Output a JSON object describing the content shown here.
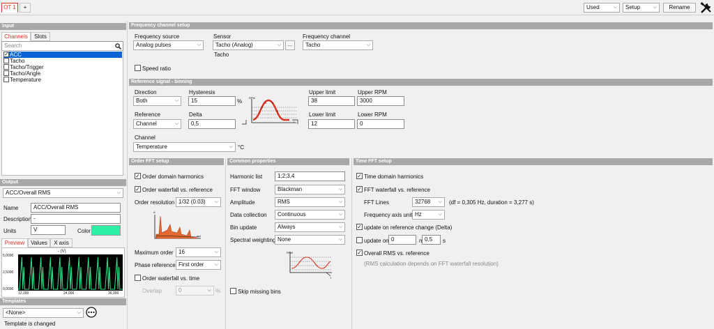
{
  "topbar": {
    "tabs": [
      {
        "label": "OT 1"
      },
      {
        "label": "+"
      }
    ],
    "used_select": "Used",
    "setup_select": "Setup",
    "rename_button": "Rename"
  },
  "colors": {
    "accent_red": "#d7301f",
    "header_gray": "#a8a8a8",
    "selection_blue": "#0a64d7",
    "color_swatch": "#2ef0a4",
    "trace_green": "#2ee88c"
  },
  "input": {
    "header": "Input",
    "tabs": [
      "Channels",
      "Slots"
    ],
    "search_placeholder": "Search",
    "channels": [
      {
        "label": "ACC",
        "checked": true,
        "selected": true
      },
      {
        "label": "Tacho",
        "checked": false,
        "selected": false
      },
      {
        "label": "Tacho/Trigger",
        "checked": false,
        "selected": false
      },
      {
        "label": "Tacho/Angle",
        "checked": false,
        "selected": false
      },
      {
        "label": "Temperature",
        "checked": false,
        "selected": false
      }
    ]
  },
  "output": {
    "header": "Output",
    "selected": "ACC/Overall RMS",
    "name_label": "Name",
    "name_value": "ACC/Overall RMS",
    "description_label": "Description",
    "description_value": "-",
    "units_label": "Units",
    "units_value": "V",
    "color_label": "Color",
    "tabs": [
      "Preview",
      "Values",
      "X axis"
    ],
    "preview_title": "- (V)",
    "y_ticks": [
      "5,0000",
      "2,5000",
      "0,0000"
    ],
    "x_ticks": [
      "12,000",
      "24,000",
      "36,000"
    ]
  },
  "templates": {
    "header": "Templates",
    "selected": "<None>",
    "status": "Template is changed"
  },
  "freq_setup": {
    "header": "Frequency channel setup",
    "source_label": "Frequency source",
    "source_value": "Analog pulses",
    "sensor_label": "Sensor",
    "sensor_value": "Tacho (Analog)",
    "sensor_browse": "...",
    "sensor_sub": "Tacho",
    "channel_label": "Frequency channel",
    "channel_value": "Tacho",
    "speed_ratio": "Speed ratio"
  },
  "reference": {
    "header": "Reference signal - binning",
    "direction_label": "Direction",
    "direction_value": "Both",
    "hysteresis_label": "Hysteresis",
    "hysteresis_value": "15",
    "hysteresis_unit": "%",
    "reference_label": "Reference",
    "reference_value": "Channel",
    "delta_label": "Delta",
    "delta_value": "0,5",
    "upper_limit_label": "Upper limit",
    "upper_limit_value": "38",
    "upper_rpm_label": "Upper RPM",
    "upper_rpm_value": "3000",
    "lower_limit_label": "Lower limit",
    "lower_limit_value": "12",
    "lower_rpm_label": "Lower RPM",
    "lower_rpm_value": "0",
    "channel_label": "Channel",
    "channel_value": "Temperature",
    "channel_unit": "°C",
    "graphic_y": "RPM",
    "graphic_x": "t"
  },
  "order_fft": {
    "header": "Order FFT setup",
    "domain_harmonics": "Order domain harmonics",
    "waterfall_ref": "Order waterfall vs. reference",
    "resolution_label": "Order resolution",
    "resolution_value": "1/32 (0.03)",
    "graphic_y": "A",
    "graphic_x": "ord",
    "max_order_label": "Maximum order",
    "max_order_value": "16",
    "phase_ref_label": "Phase reference",
    "phase_ref_value": "First order",
    "waterfall_time": "Order waterfall vs. time",
    "overlap_label": "Overlap",
    "overlap_value": "0",
    "overlap_unit": "%"
  },
  "common": {
    "header": "Common properties",
    "harmonic_list_label": "Harmonic list",
    "harmonic_list_value": "1;2;3,4",
    "fft_window_label": "FFT window",
    "fft_window_value": "Blackman",
    "amplitude_label": "Amplitude",
    "amplitude_value": "RMS",
    "data_collection_label": "Data collection",
    "data_collection_value": "Continuous",
    "bin_update_label": "Bin update",
    "bin_update_value": "Always",
    "spectral_weighting_label": "Spectral weighting",
    "spectral_weighting_value": "None",
    "graphic_y": "RPM",
    "graphic_x": "t",
    "skip_missing": "Skip missing bins"
  },
  "time_fft": {
    "header": "Time FFT setup",
    "domain_harmonics": "Time domain harmonics",
    "waterfall_ref": "FFT waterfall vs. reference",
    "fft_lines_label": "FFT Lines",
    "fft_lines_value": "32768",
    "fft_lines_info": "(df = 0,305 Hz, duration = 3,277 s)",
    "freq_unit_label": "Frequency axis unit",
    "freq_unit_value": "Hz",
    "update_ref": "update on reference change (Delta)",
    "update_on_label": "update on",
    "update_on_value": "0",
    "min_label": "min",
    "sec_value": "0,5",
    "sec_label": "s",
    "overall_rms": "Overall RMS vs. reference",
    "rms_note": "(RMS calculation depends on FFT waterfall resolution)"
  }
}
